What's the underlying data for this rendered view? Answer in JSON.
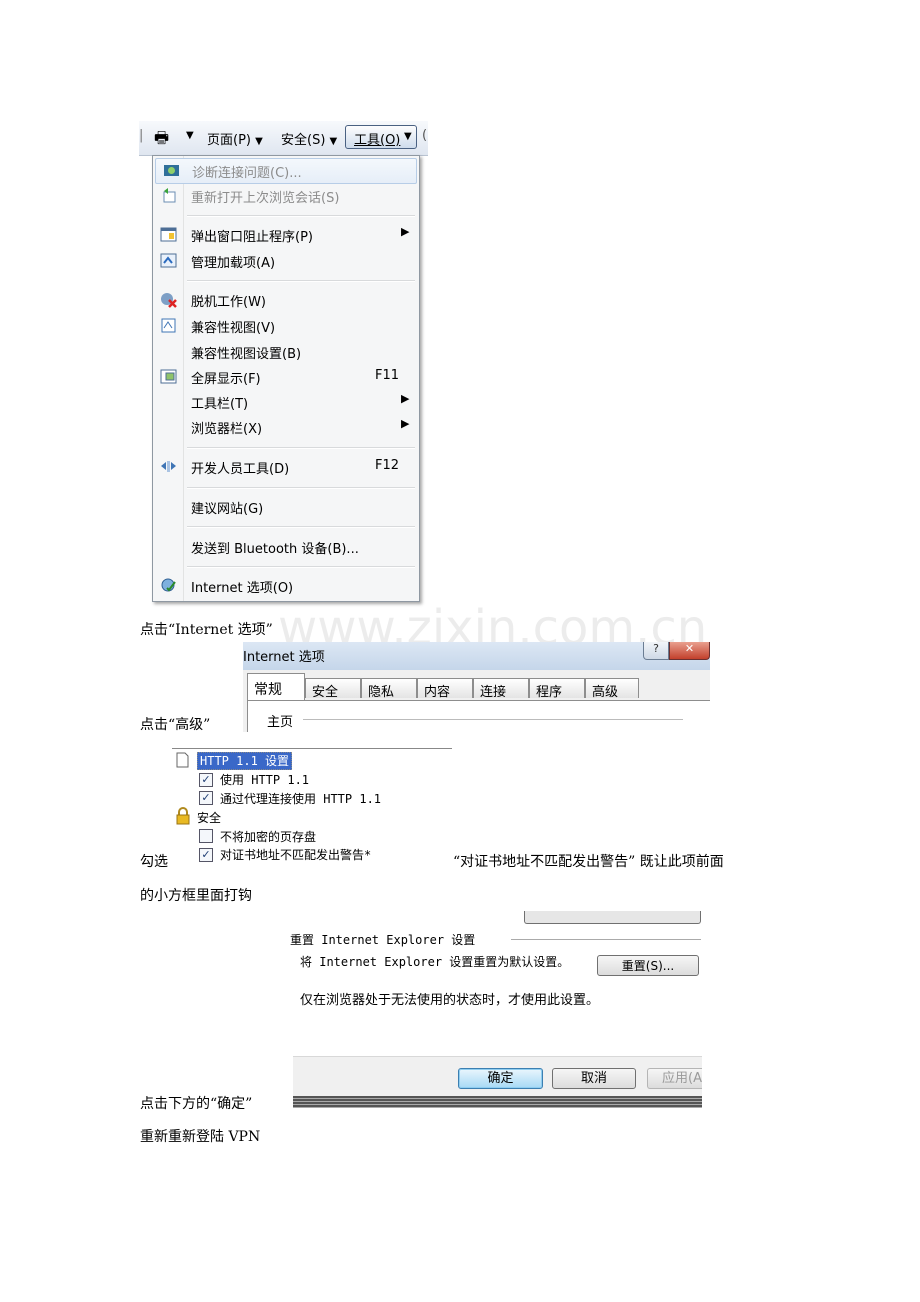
{
  "ie_toolbar": {
    "page_label": "页面(P)",
    "safety_label": "安全(S)",
    "tools_label": "工具(O)"
  },
  "ie_menu": {
    "items": [
      {
        "label": "诊断连接问题(C)...",
        "icon": "diagnose-icon"
      },
      {
        "label": "重新打开上次浏览会话(S)",
        "icon": "reopen-session-icon"
      },
      {
        "label": "弹出窗口阻止程序(P)",
        "icon": "popup-blocker-icon"
      },
      {
        "label": "管理加载项(A)",
        "icon": "addons-icon"
      },
      {
        "label": "脱机工作(W)",
        "icon": "offline-icon"
      },
      {
        "label": "兼容性视图(V)",
        "icon": "compat-view-icon"
      },
      {
        "label": "兼容性视图设置(B)"
      },
      {
        "label": "全屏显示(F)",
        "shortcut": "F11",
        "icon": "fullscreen-icon"
      },
      {
        "label": "工具栏(T)"
      },
      {
        "label": "浏览器栏(X)"
      },
      {
        "label": "开发人员工具(D)",
        "shortcut": "F12",
        "icon": "dev-tools-icon"
      },
      {
        "label": "建议网站(G)"
      },
      {
        "label": "发送到 Bluetooth 设备(B)..."
      },
      {
        "label": "Internet 选项(O)",
        "icon": "internet-options-icon"
      }
    ]
  },
  "text1": "点击“Internet 选项”",
  "watermark": "www.zixin.com.cn",
  "dialog": {
    "title": "Internet 选项",
    "tabs": [
      "常规",
      "安全",
      "隐私",
      "内容",
      "连接",
      "程序",
      "高级"
    ],
    "home_label": "主页"
  },
  "text2": "点击“高级”",
  "advanced": {
    "http_group": "HTTP 1.1 设置",
    "use_http": "使用 HTTP 1.1",
    "proxy_http": "通过代理连接使用 HTTP 1.1",
    "security_group": "安全",
    "no_save_encrypted": "不将加密的页存盘",
    "cert_mismatch": "对证书地址不匹配发出警告*"
  },
  "text3a": "勾选",
  "text3b": "“对证书地址不匹配发出警告” 既让此项前面",
  "text3c": "的小方框里面打钩",
  "reset": {
    "group": "重置 Internet Explorer 设置",
    "desc": "将 Internet Explorer 设置重置为默认设置。",
    "button": "重置(S)...",
    "note": "仅在浏览器处于无法使用的状态时，才使用此设置。"
  },
  "footer_buttons": {
    "ok": "确定",
    "cancel": "取消",
    "apply": "应用(A"
  },
  "text4": "点击下方的“确定”",
  "text5": "重新重新登陆 VPN"
}
